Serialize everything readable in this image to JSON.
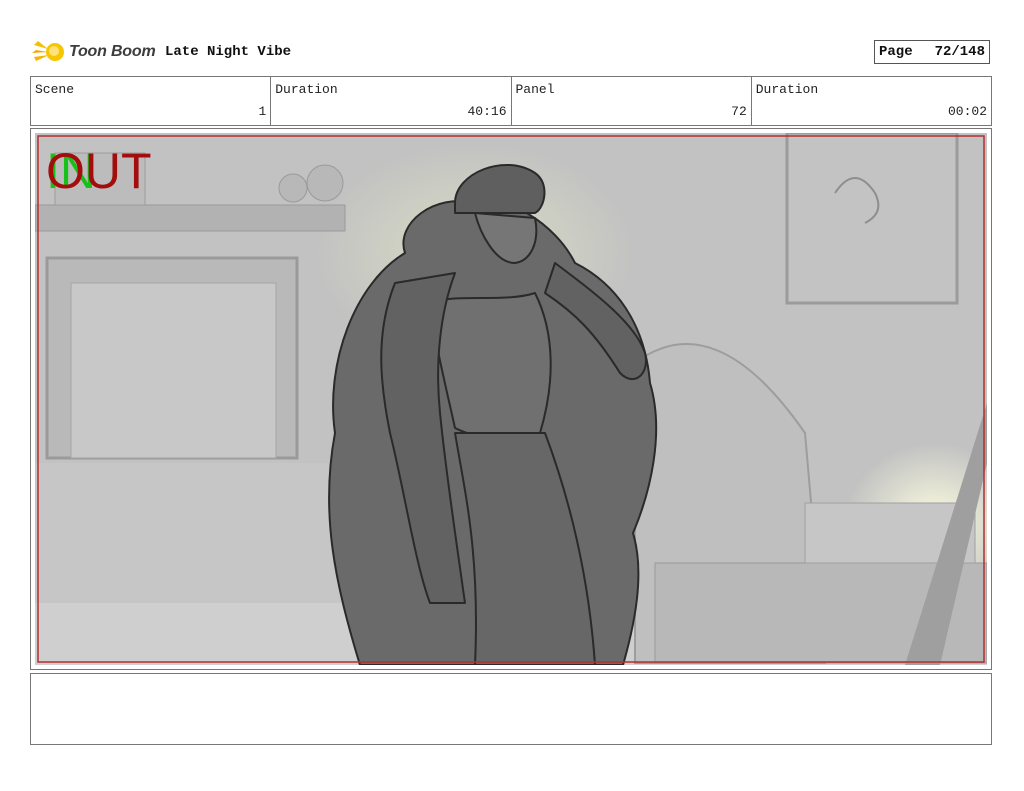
{
  "header": {
    "logo_text": "Toon Boom",
    "project_title": "Late Night Vibe",
    "page_label": "Page",
    "page_value": "72/148"
  },
  "info": [
    {
      "label": "Scene",
      "value": "1"
    },
    {
      "label": "Duration",
      "value": "40:16"
    },
    {
      "label": "Panel",
      "value": "72"
    },
    {
      "label": "Duration",
      "value": "00:02"
    }
  ],
  "panel": {
    "in_marker": "IN",
    "out_marker": "OUT",
    "frame_color": "#b03030",
    "in_color": "#18c11a",
    "out_color": "#a30d0d"
  },
  "notes": {
    "text": ""
  }
}
